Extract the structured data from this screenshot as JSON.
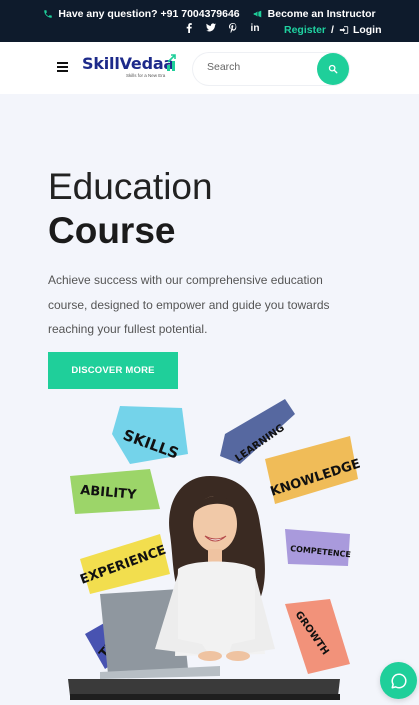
{
  "topbar": {
    "question_label": "Have any question? +91 7004379646",
    "instructor_label": "Become an Instructor",
    "register_label": "Register",
    "separator": "/",
    "login_label": "Login"
  },
  "header": {
    "logo": {
      "part1": "Skill",
      "part2": "Vedaa",
      "tagline": "Skills for a New Era"
    },
    "search": {
      "placeholder": "Search",
      "value": ""
    }
  },
  "hero": {
    "title_line1": "Education",
    "title_line2": "Course",
    "description": "Achieve success with our comprehensive education course, designed to empower and guide you towards reaching your fullest potential.",
    "cta_label": "DISCOVER MORE"
  },
  "illustration": {
    "words": [
      "SKILLS",
      "LEARNING",
      "ABILITY",
      "KNOWLEDGE",
      "EXPERIENCE",
      "COMPETENCE",
      "TRAINING",
      "GROWTH"
    ]
  },
  "colors": {
    "accent": "#1fcf9a",
    "topbar_bg": "#0e1b2c",
    "page_bg": "#f3f5fb",
    "brand": "#1d2a8a"
  },
  "icons": {
    "phone": "phone-icon",
    "megaphone": "megaphone-icon",
    "facebook": "facebook-icon",
    "twitter": "twitter-icon",
    "pinterest": "pinterest-icon",
    "linkedin": "linkedin-icon",
    "login": "login-icon",
    "menu": "hamburger-icon",
    "search": "search-icon",
    "chat": "chat-icon"
  }
}
